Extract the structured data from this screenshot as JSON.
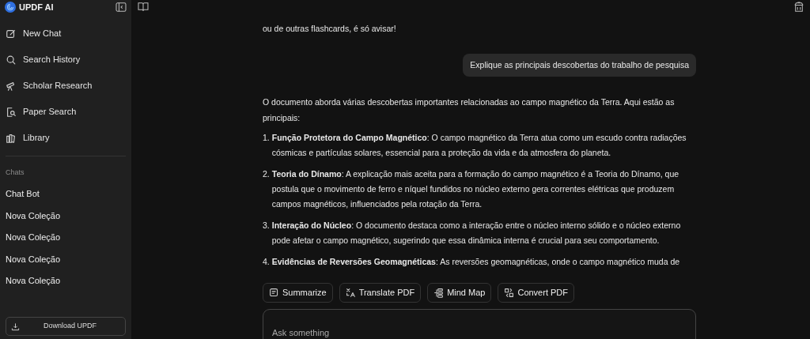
{
  "sidebar": {
    "brand": "UPDF AI",
    "nav": [
      "New Chat",
      "Search History",
      "Scholar Research",
      "Paper Search",
      "Library"
    ],
    "section": "Chats",
    "chats": [
      "Chat Bot",
      "Nova Coleção",
      "Nova Coleção",
      "Nova Coleção",
      "Nova Coleção"
    ],
    "download": "Download UPDF"
  },
  "messages": [
    {
      "kind": "assistant",
      "text": "ou de outras flashcards, é só avisar!"
    },
    {
      "kind": "user",
      "text": "Explique as principais descobertas do trabalho de pesquisa"
    },
    {
      "kind": "assistant",
      "text": "O documento aborda várias descobertas importantes relacionadas ao campo magnético da Terra. Aqui estão as principais:",
      "list": [
        {
          "number": "1.",
          "text": "**Função Protetora do Campo Magnético**: O campo magnético da Terra atua como um escudo contra radiações cósmicas e partículas solares, essencial para a proteção da vida e da atmosfera do planeta."
        },
        {
          "number": "2.",
          "text": "**Teoria do Dínamo**: A explicação mais aceita para a formação do campo magnético é a Teoria do Dínamo, que postula que o movimento de ferro e níquel fundidos no núcleo externo gera correntes elétricas que produzem campos magnéticos, influenciados pela rotação da Terra."
        },
        {
          "number": "3.",
          "text": "**Interação do Núcleo**: O documento destaca como a interação entre o núcleo interno sólido e o núcleo externo pode afetar o campo magnético, sugerindo que essa dinâmica interna é crucial para seu comportamento."
        },
        {
          "number": "4.",
          "text": "**Evidências de Reversões Geomagnéticas**: As reversões geomagnéticas, onde o campo magnético muda de"
        }
      ]
    }
  ],
  "actions": [
    "Summarize",
    "Translate PDF",
    "Mind Map",
    "Convert PDF"
  ],
  "input": {
    "placeholder": "Ask something"
  }
}
